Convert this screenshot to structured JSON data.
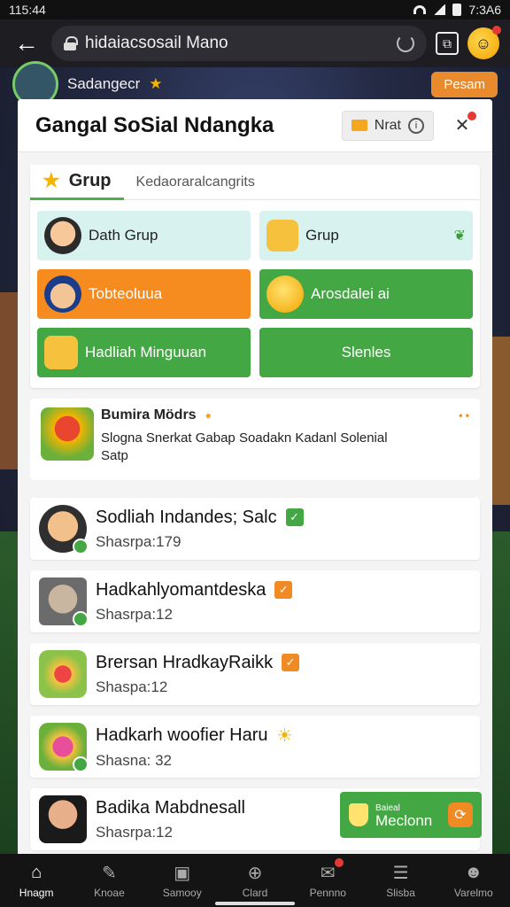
{
  "status_bar": {
    "time": "115:44",
    "time_right": "7:3A6"
  },
  "browser": {
    "url": "hidaiacsosail Mano"
  },
  "behind": {
    "name": "Sadangecr",
    "button": "Pesam"
  },
  "modal": {
    "title": "Gangal SoSial Ndangka",
    "notif_label": "Nrat",
    "tabs": {
      "active": "Grup",
      "inactive": "Kedaoraralcangrits"
    },
    "tiles": [
      {
        "label": "Dath Grup"
      },
      {
        "label": "Grup"
      },
      {
        "label": "Tobteoluua"
      },
      {
        "label": "Arosdalei ai"
      },
      {
        "label": "Hadliah Minguuan"
      },
      {
        "label": "Slenles"
      }
    ],
    "feature": {
      "title": "Bumira Mödrs",
      "line1": "Slogna Snerkat  Gabap Soadakn  Kadanl Solenial",
      "line2": "Satp"
    },
    "list": [
      {
        "title": "Sodliah Indandes; Salc",
        "sub": "Shasrpa:179"
      },
      {
        "title": "Hadkahlyomantdeska",
        "sub": "Shasrpa:12"
      },
      {
        "title": "Brersan HradkayRaikk",
        "sub": "Shaspa:12"
      },
      {
        "title": "Hadkarh woofier Haru",
        "sub": "Shasna: 32"
      },
      {
        "title": "Badika Mabdnesall",
        "sub": "Shasrpa:12"
      }
    ],
    "cta": {
      "small": "Baieal",
      "big": "Meclonn"
    }
  },
  "nav": [
    {
      "label": "Hnagm",
      "icon": "home-icon"
    },
    {
      "label": "Knoae",
      "icon": "edit-icon"
    },
    {
      "label": "Samooy",
      "icon": "media-icon"
    },
    {
      "label": "Clard",
      "icon": "plus-circle-icon"
    },
    {
      "label": "Pennno",
      "icon": "inbox-icon"
    },
    {
      "label": "Slisba",
      "icon": "list-icon"
    },
    {
      "label": "Varelmo",
      "icon": "profile-icon"
    }
  ]
}
